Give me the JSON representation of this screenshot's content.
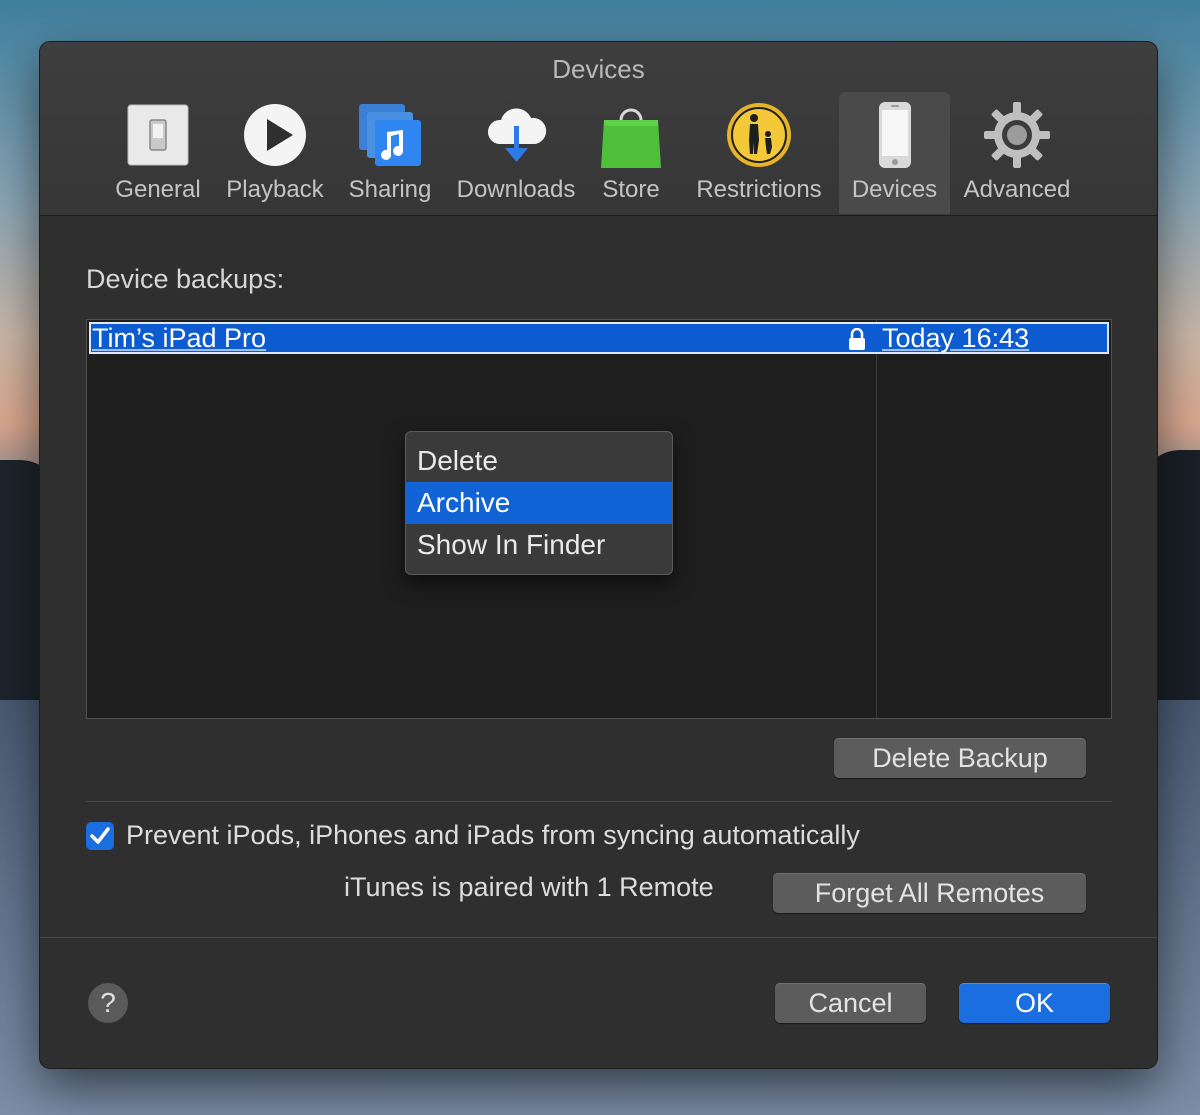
{
  "window": {
    "title": "Devices"
  },
  "toolbar": {
    "tabs": [
      {
        "label": "General",
        "icon": "general-switch-icon"
      },
      {
        "label": "Playback",
        "icon": "play-icon"
      },
      {
        "label": "Sharing",
        "icon": "music-sharing-icon"
      },
      {
        "label": "Downloads",
        "icon": "cloud-download-icon"
      },
      {
        "label": "Store",
        "icon": "shopping-bag-icon"
      },
      {
        "label": "Restrictions",
        "icon": "parental-restrictions-icon"
      },
      {
        "label": "Devices",
        "icon": "iphone-icon",
        "selected": true
      },
      {
        "label": "Advanced",
        "icon": "gear-icon"
      }
    ]
  },
  "backups": {
    "label": "Device backups:",
    "rows": [
      {
        "name": "Tim’s iPad Pro",
        "date": "Today 16:43",
        "locked": true
      }
    ],
    "delete_label": "Delete Backup"
  },
  "context_menu": {
    "items": [
      {
        "label": "Delete"
      },
      {
        "label": "Archive",
        "highlighted": true
      },
      {
        "label": "Show In Finder"
      }
    ]
  },
  "options": {
    "prevent_sync_label": "Prevent iPods, iPhones and iPads from syncing automatically",
    "prevent_sync_checked": true,
    "paired_text": "iTunes is paired with 1 Remote",
    "forget_remotes_label": "Forget All Remotes"
  },
  "footer": {
    "help_label": "?",
    "cancel_label": "Cancel",
    "ok_label": "OK"
  },
  "colors": {
    "accent": "#1a6ee0",
    "selection": "#0d5bd0",
    "window_bg": "#323232"
  }
}
